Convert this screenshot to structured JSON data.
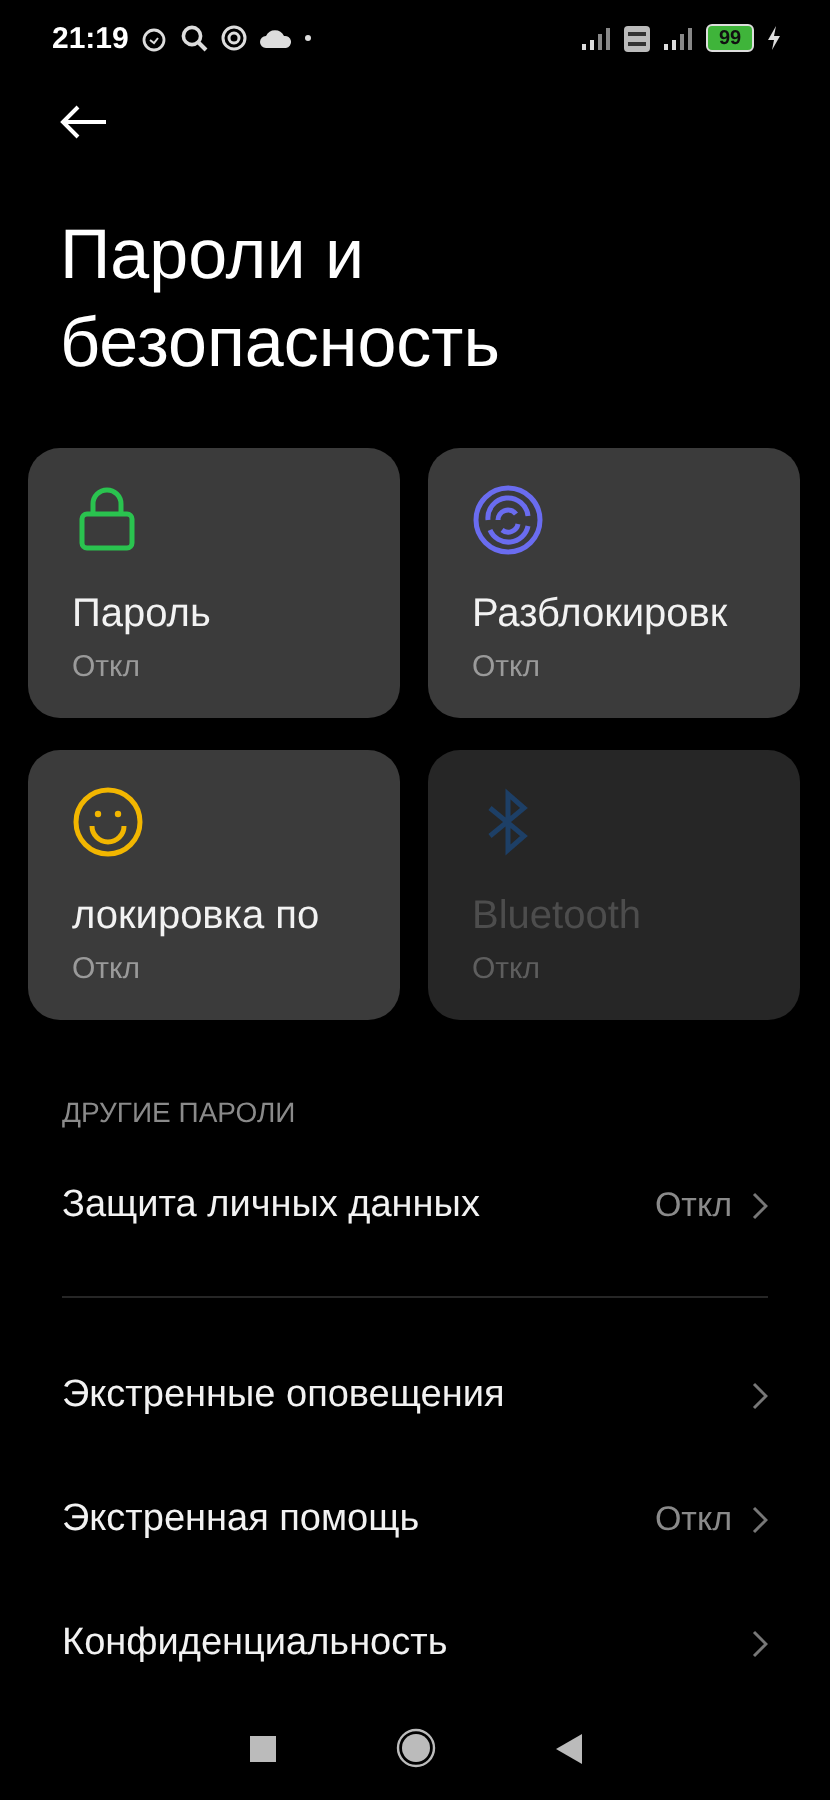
{
  "status_bar": {
    "time": "21:19",
    "battery": "99"
  },
  "title": "Пароли и безопасность",
  "tiles": [
    {
      "kind": "lock",
      "label": "Пароль",
      "status": "Откл",
      "disabled": false
    },
    {
      "kind": "fingerprint",
      "label": "Разблокировк",
      "status": "Откл",
      "disabled": false
    },
    {
      "kind": "face",
      "label": "локировка по",
      "status": "Откл",
      "disabled": false
    },
    {
      "kind": "bluetooth",
      "label": "Bluetooth",
      "status": "Откл",
      "disabled": true
    }
  ],
  "section_header": "ДРУГИЕ ПАРОЛИ",
  "rows": [
    {
      "label": "Защита личных данных",
      "value": "Откл",
      "divider_after": true
    },
    {
      "label": "Экстренные оповещения"
    },
    {
      "label": "Экстренная помощь",
      "value": "Откл"
    },
    {
      "label": "Конфиденциальность"
    }
  ]
}
